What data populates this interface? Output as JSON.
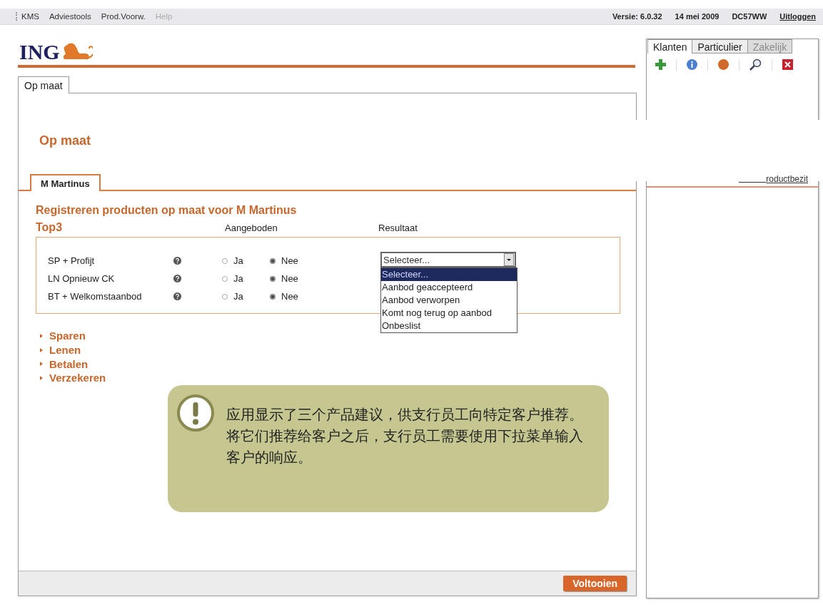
{
  "menu": [
    {
      "label": "KMS",
      "disabled": false
    },
    {
      "label": "Adviestools",
      "disabled": false
    },
    {
      "label": "Prod.Voorw.",
      "disabled": false
    },
    {
      "label": "Help",
      "disabled": true
    }
  ],
  "status": {
    "version": "Versie: 6.0.32",
    "date": "14 mei 2009",
    "user": "DC57WW",
    "logout": "Uitloggen"
  },
  "main_tabs": [
    {
      "label": "Op maat",
      "selected": true
    }
  ],
  "logo": "ING",
  "page_title": "Op maat",
  "customer_tabs": [
    {
      "label": "M Martinus",
      "selected": true
    }
  ],
  "section_title": "Registreren producten op maat voor M Martinus",
  "top3": {
    "title": "Top3",
    "columns": [
      "Aangeboden",
      "Resultaat"
    ],
    "rows": [
      {
        "name": "SP + Profijt",
        "options": [
          {
            "label": "Ja",
            "selected": false
          },
          {
            "label": "Nee",
            "selected": true
          }
        ],
        "result": "Selecteer..."
      },
      {
        "name": "LN Opnieuw CK",
        "options": [
          {
            "label": "Ja",
            "selected": false
          },
          {
            "label": "Nee",
            "selected": true
          }
        ]
      },
      {
        "name": "BT + Welkomstaanbod",
        "options": [
          {
            "label": "Ja",
            "selected": false
          },
          {
            "label": "Nee",
            "selected": true
          }
        ]
      }
    ],
    "dropdown_options": [
      {
        "label": "Selecteer...",
        "selected": true
      },
      {
        "label": "Aanbod geaccepteerd",
        "selected": false
      },
      {
        "label": "Aanbod verworpen",
        "selected": false
      },
      {
        "label": "Komt nog terug op aanbod",
        "selected": false
      },
      {
        "label": "Onbeslist",
        "selected": false
      }
    ]
  },
  "categories": [
    "Sparen",
    "Lenen",
    "Betalen",
    "Verzekeren"
  ],
  "finish_button": "Voltooien",
  "side_panel": {
    "tabs": [
      {
        "label": "Klanten",
        "selected": true,
        "disabled": false
      },
      {
        "label": "Particulier",
        "selected": false,
        "disabled": false
      },
      {
        "label": "Zakelijk",
        "selected": false,
        "disabled": true
      }
    ],
    "toolbar": [
      {
        "kind": "add"
      },
      {
        "kind": "info"
      },
      {
        "kind": "dot"
      },
      {
        "kind": "search"
      },
      {
        "kind": "close"
      }
    ],
    "link": "roductbezit"
  },
  "callout": {
    "text": "应用显示了三个产品建议，供支行员工向特定客户推荐。将它们推荐给客户之后，支行员工需要使用下拉菜单输入客户的响应。"
  }
}
